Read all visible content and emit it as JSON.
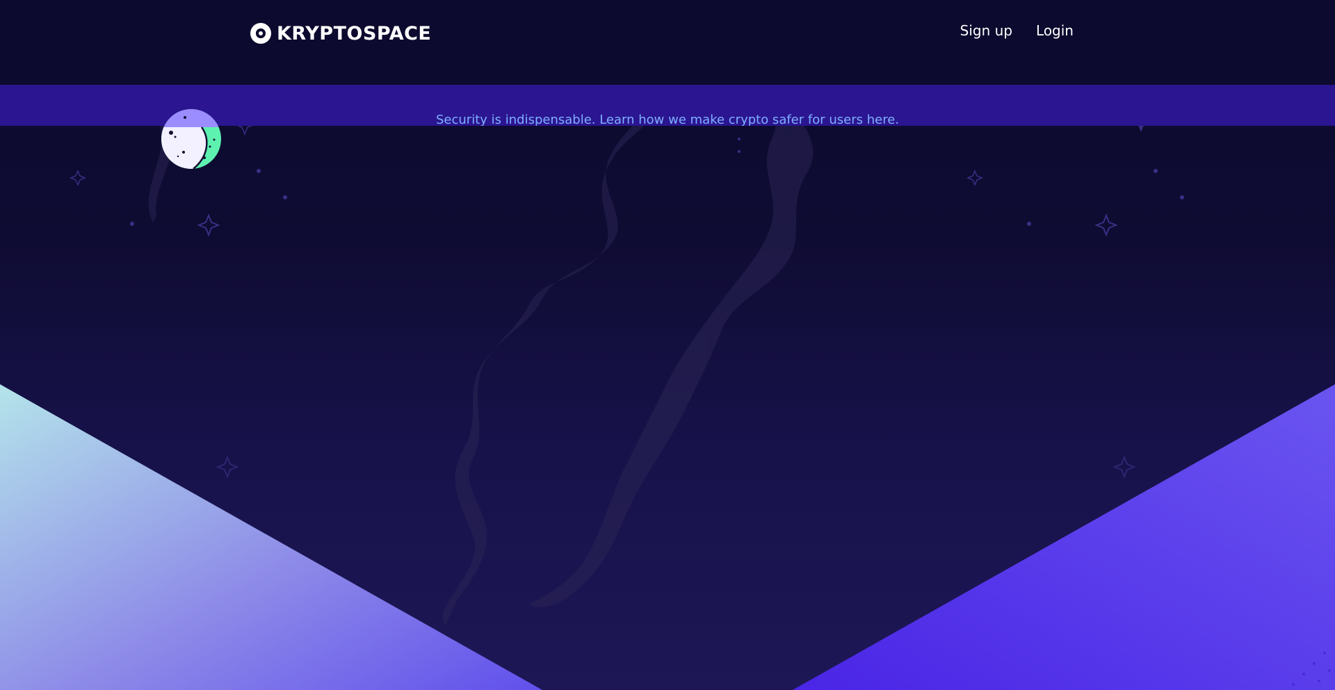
{
  "header": {
    "brand": "KRYPTOSPACE",
    "nav": [
      {
        "label": "Sign up"
      },
      {
        "label": "Login"
      }
    ]
  },
  "banner": {
    "message": "Security is indispensable. Learn how we make crypto safer for users here."
  },
  "colors": {
    "background": "#0c0a2e",
    "banner": "#2b1591",
    "banner_text": "#7fb0ff",
    "accent_green": "#5ef2b0",
    "accent_purple": "#9b8cff"
  }
}
